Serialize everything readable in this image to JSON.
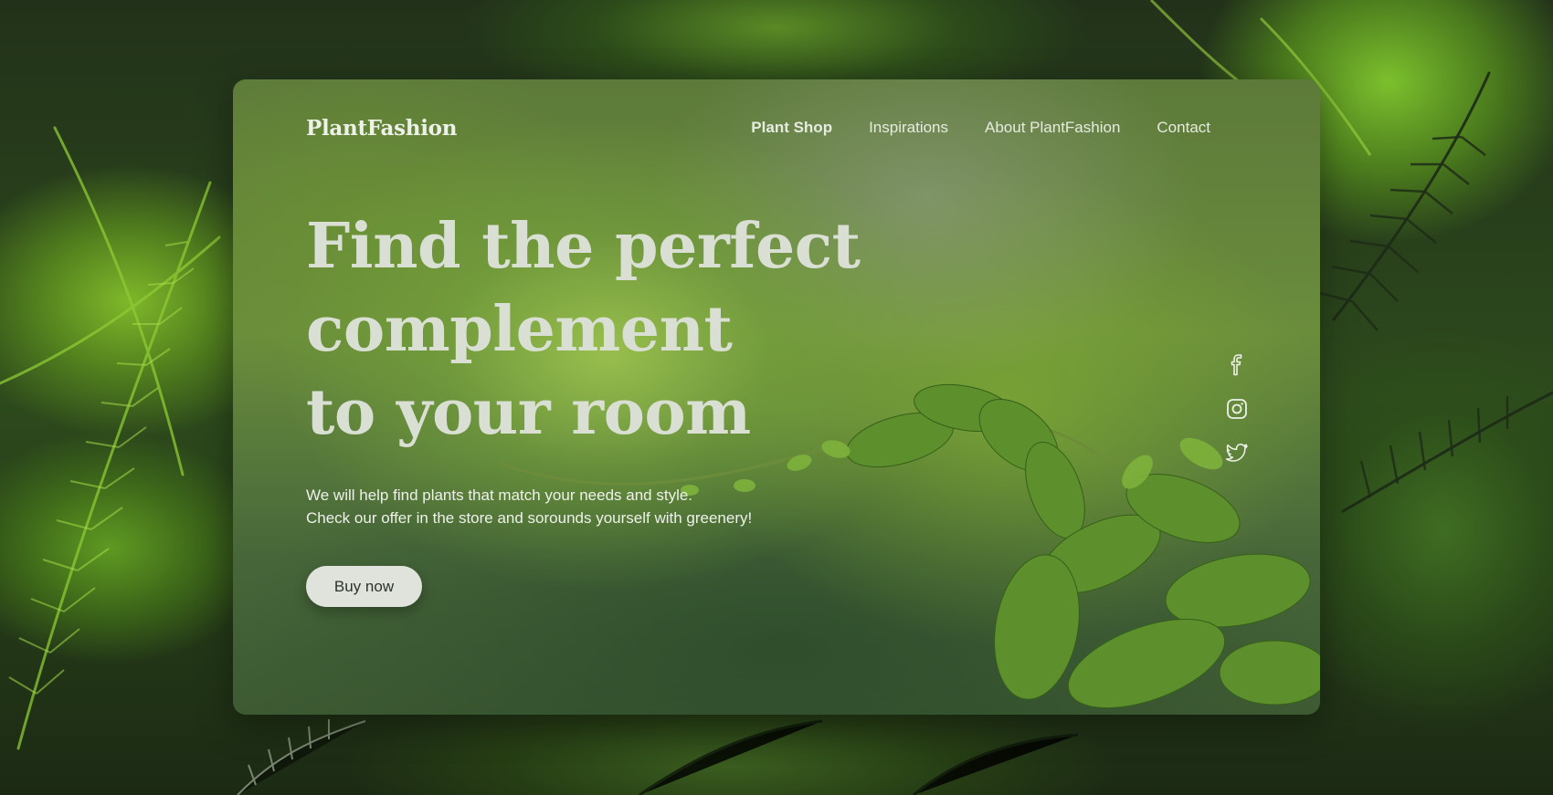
{
  "brand": {
    "logo_text": "PlantFashion"
  },
  "nav": {
    "items": [
      {
        "label": "Plant Shop",
        "active": true
      },
      {
        "label": "Inspirations",
        "active": false
      },
      {
        "label": "About PlantFashion",
        "active": false
      },
      {
        "label": "Contact",
        "active": false
      }
    ]
  },
  "hero": {
    "title_lines": [
      "Find the perfect",
      "complement",
      "to your room"
    ],
    "text_lines": [
      "We will help find plants that match your needs and style.",
      "Check our offer in the store and sorounds yourself with greenery!"
    ],
    "button_label": "Buy now"
  },
  "social": {
    "icons": [
      "facebook-icon",
      "instagram-icon",
      "twitter-icon"
    ]
  },
  "colors": {
    "text_light": "#eef1e8",
    "title": "#d9dfd3",
    "button_bg": "#dfe3dc",
    "button_text": "#2c3328",
    "foliage": "#6a8d3c"
  }
}
